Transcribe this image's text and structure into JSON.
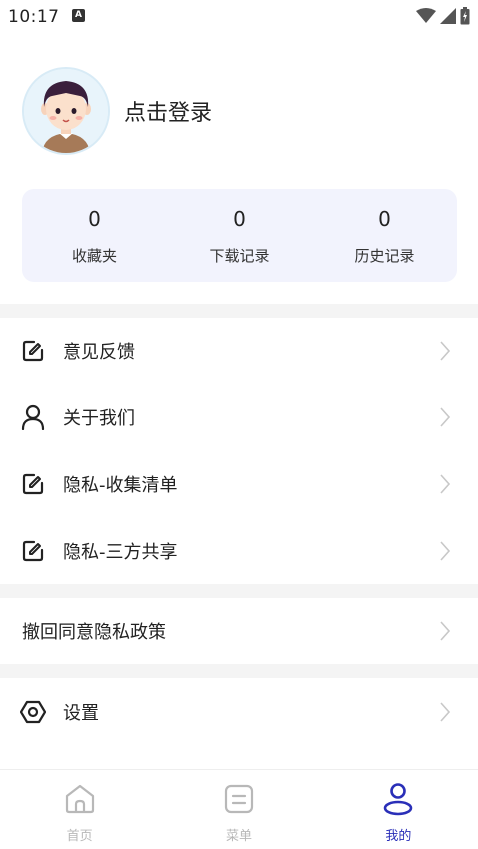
{
  "status_bar": {
    "time": "10:17",
    "notification_icon": "a-icon"
  },
  "profile": {
    "login_prompt": "点击登录"
  },
  "stats": [
    {
      "value": "0",
      "label": "收藏夹"
    },
    {
      "value": "0",
      "label": "下载记录"
    },
    {
      "value": "0",
      "label": "历史记录"
    }
  ],
  "menu": {
    "feedback": "意见反馈",
    "about": "关于我们",
    "privacy_collection": "隐私-收集清单",
    "privacy_sharing": "隐私-三方共享",
    "revoke_consent": "撤回同意隐私政策",
    "settings": "设置"
  },
  "bottom_nav": {
    "items": [
      {
        "label": "首页",
        "icon": "home-icon"
      },
      {
        "label": "菜单",
        "icon": "menu-icon"
      },
      {
        "label": "我的",
        "icon": "profile-icon"
      }
    ],
    "active_index": 2
  },
  "colors": {
    "accent": "#2a2fb8",
    "card_bg": "#f2f3fd",
    "band_bg": "#f4f4f4",
    "inactive_nav": "#b8b8b8"
  }
}
